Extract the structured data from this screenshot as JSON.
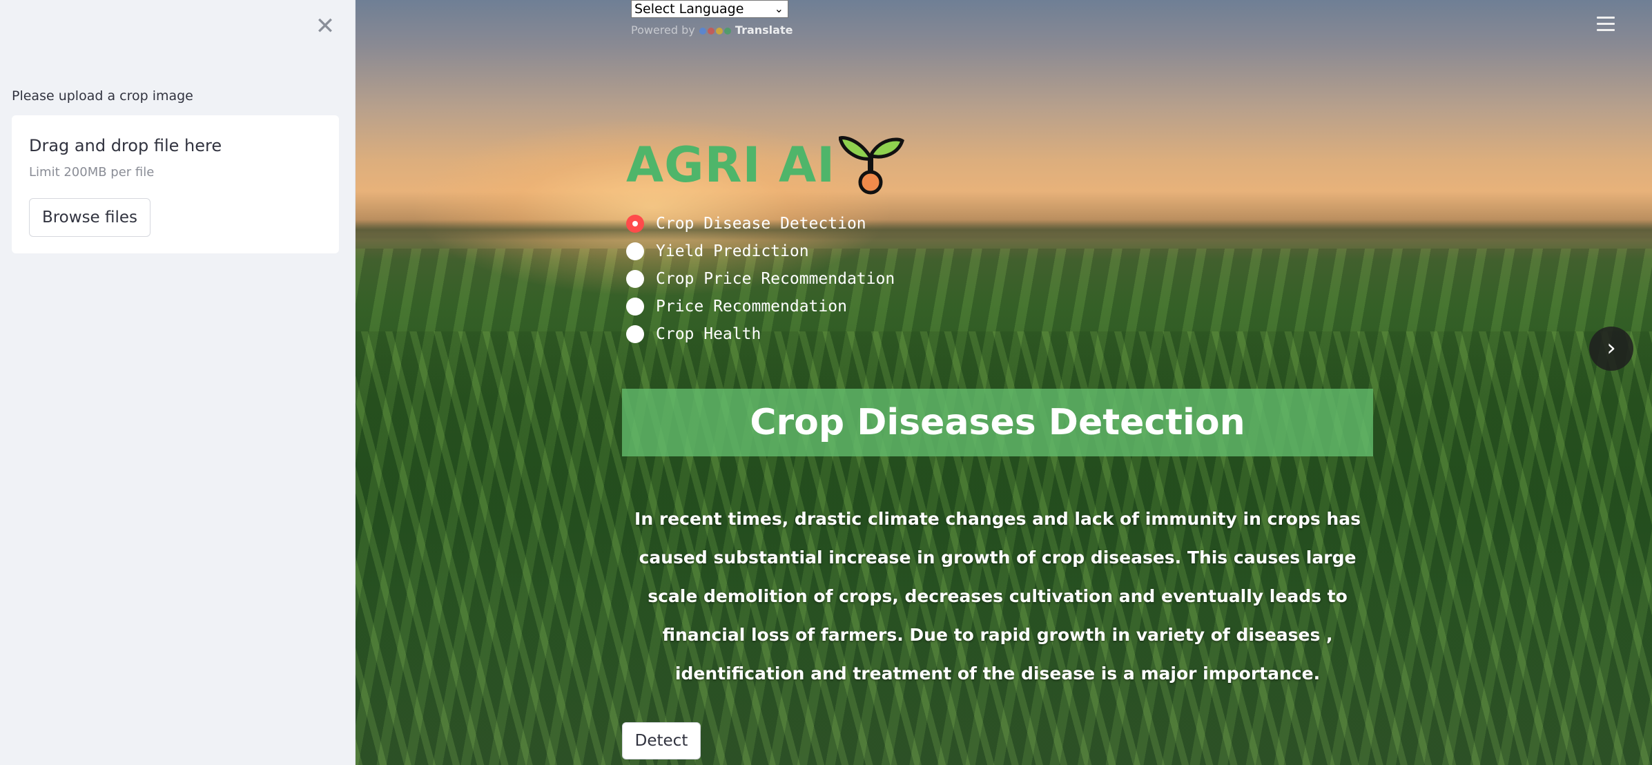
{
  "sidebar": {
    "close_symbol": "✕",
    "upload_label": "Please upload a crop image",
    "dropzone": {
      "title": "Drag and drop file here",
      "limit": "Limit 200MB per file",
      "browse_label": "Browse files"
    }
  },
  "translate": {
    "select_value": "Select Language",
    "powered_by": "Powered by",
    "translate_word": "Translate"
  },
  "header": {
    "app_title": "AGRI AI",
    "menu_icon": "hamburger-icon",
    "next_icon": "chevron-right-icon"
  },
  "nav": {
    "options": [
      {
        "label": "Crop Disease Detection",
        "selected": true
      },
      {
        "label": "Yield Prediction",
        "selected": false
      },
      {
        "label": "Crop Price Recommendation",
        "selected": false
      },
      {
        "label": "Price Recommendation",
        "selected": false
      },
      {
        "label": "Crop Health",
        "selected": false
      }
    ]
  },
  "main": {
    "banner_title": "Crop Diseases Detection",
    "description": "In recent times, drastic climate changes and lack of immunity in crops has caused substantial increase in growth of crop diseases. This causes large scale demolition of crops, decreases cultivation and eventually leads to financial loss of farmers. Due to rapid growth in variety of diseases , identification and treatment of the disease is a major importance.",
    "detect_label": "Detect"
  },
  "colors": {
    "accent": "#ff4b4b",
    "title_green": "#4fb56a",
    "banner_green": "#64be6e"
  }
}
